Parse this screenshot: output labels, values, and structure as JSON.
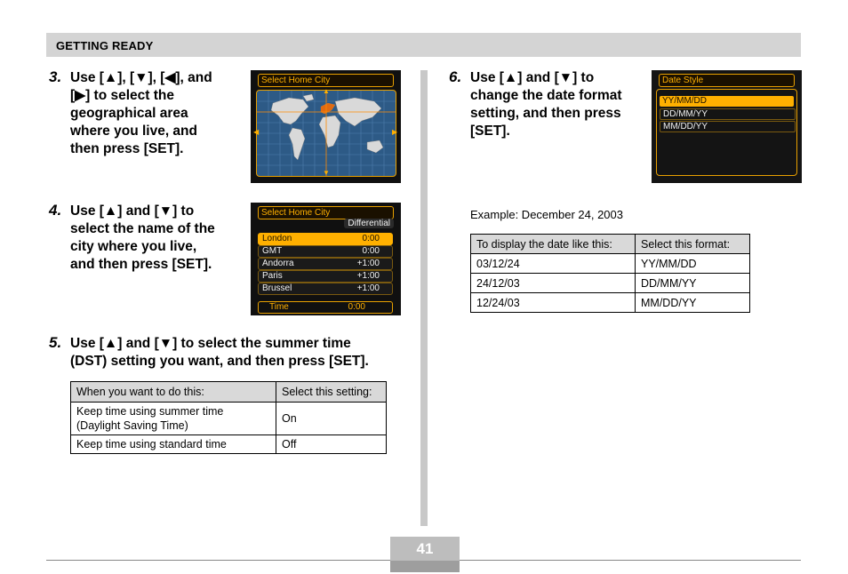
{
  "header": {
    "section_title": "GETTING READY"
  },
  "steps": {
    "s3": {
      "num": "3.",
      "text": "Use [▲], [▼], [◀], and\n[▶] to select the\ngeographical area\nwhere you live, and\nthen press [SET]."
    },
    "s4": {
      "num": "4.",
      "text": "Use [▲] and [▼] to\nselect the name of the\ncity where you live,\nand then press [SET]."
    },
    "s5": {
      "num": "5.",
      "text": "Use [▲] and [▼] to select the summer time\n(DST) setting you want, and then press [SET]."
    },
    "s6": {
      "num": "6.",
      "text": "Use [▲] and [▼] to\nchange the date format\nsetting, and then press\n[SET]."
    }
  },
  "lcd_map": {
    "title": "Select Home City"
  },
  "lcd_city": {
    "title": "Select Home City",
    "column_label": "Differential",
    "rows": [
      {
        "name": "London",
        "offset": "0:00"
      },
      {
        "name": "GMT",
        "offset": "0:00"
      },
      {
        "name": "Andorra",
        "offset": "+1:00"
      },
      {
        "name": "Paris",
        "offset": "+1:00"
      },
      {
        "name": "Brussel",
        "offset": "+1:00"
      }
    ],
    "footer_label": "Time",
    "footer_value": "0:00"
  },
  "lcd_date": {
    "title": "Date Style",
    "options": [
      "YY/MM/DD",
      "DD/MM/YY",
      "MM/DD/YY"
    ]
  },
  "dst_table": {
    "headers": [
      "When you want to do this:",
      "Select this setting:"
    ],
    "rows": [
      [
        "Keep time using summer time\n(Daylight Saving Time)",
        "On"
      ],
      [
        "Keep time using standard time",
        "Off"
      ]
    ]
  },
  "example_text": "Example: December 24, 2003",
  "date_table": {
    "headers": [
      "To display the date like this:",
      "Select this format:"
    ],
    "rows": [
      [
        "03/12/24",
        "YY/MM/DD"
      ],
      [
        "24/12/03",
        "DD/MM/YY"
      ],
      [
        "12/24/03",
        "MM/DD/YY"
      ]
    ]
  },
  "page_number": "41",
  "colors": {
    "accent": "#ffb000",
    "header_bg": "#d4d4d4",
    "lcd_bg": "#101010"
  }
}
